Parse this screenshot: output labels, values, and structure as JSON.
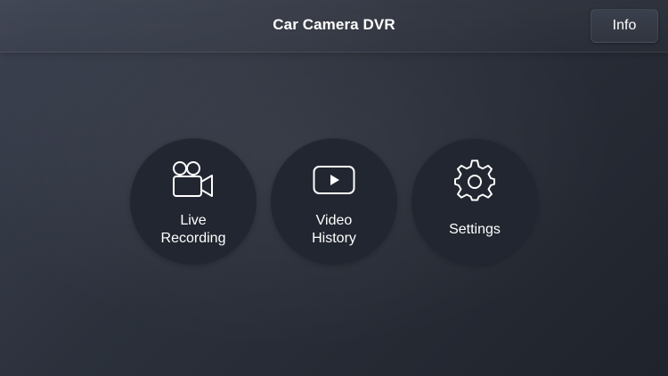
{
  "header": {
    "title": "Car Camera DVR",
    "info_label": "Info"
  },
  "menu": {
    "items": [
      {
        "label_line1": "Live",
        "label_line2": "Recording",
        "icon": "video-camera-icon"
      },
      {
        "label_line1": "Video",
        "label_line2": "History",
        "icon": "play-video-icon"
      },
      {
        "label": "Settings",
        "icon": "gear-icon"
      }
    ]
  },
  "colors": {
    "background": "#2f3440",
    "button": "#222630",
    "text": "#ffffff"
  }
}
